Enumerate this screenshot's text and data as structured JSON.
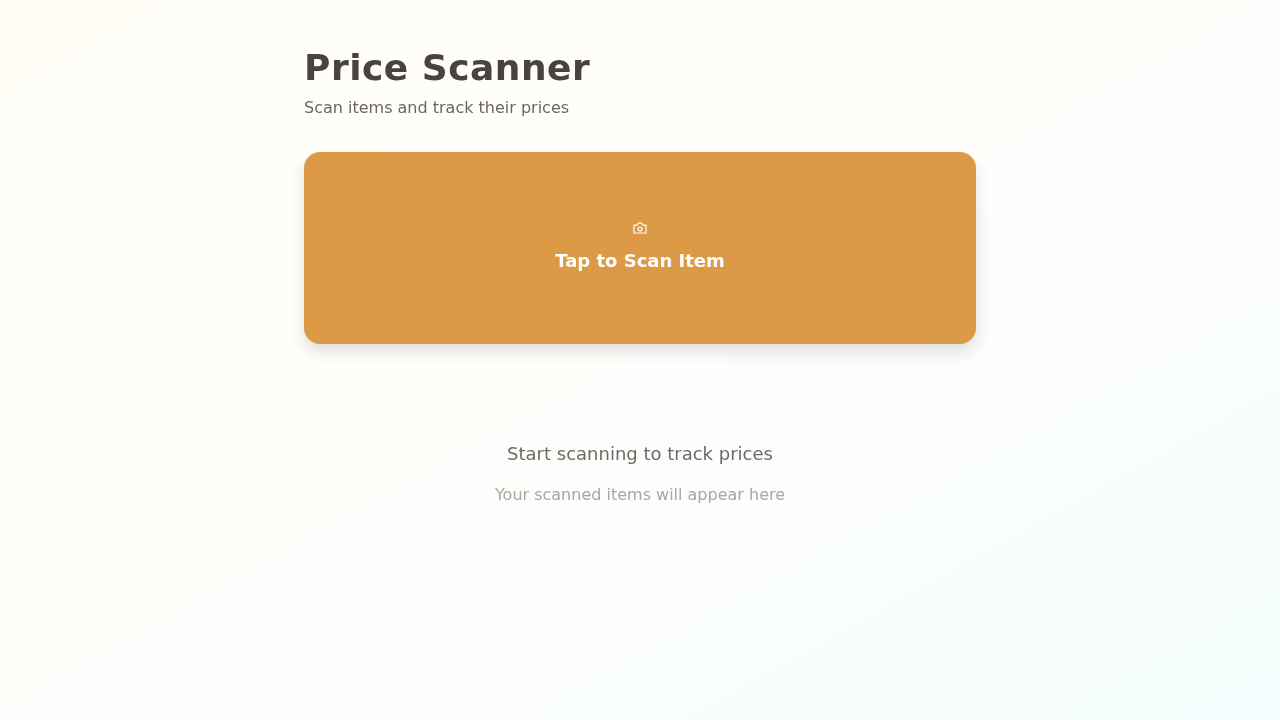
{
  "header": {
    "title": "Price Scanner",
    "subtitle": "Scan items and track their prices"
  },
  "scan_button": {
    "label": "Tap to Scan Item"
  },
  "empty_state": {
    "title": "Start scanning to track prices",
    "message": "Your scanned items will appear here"
  }
}
